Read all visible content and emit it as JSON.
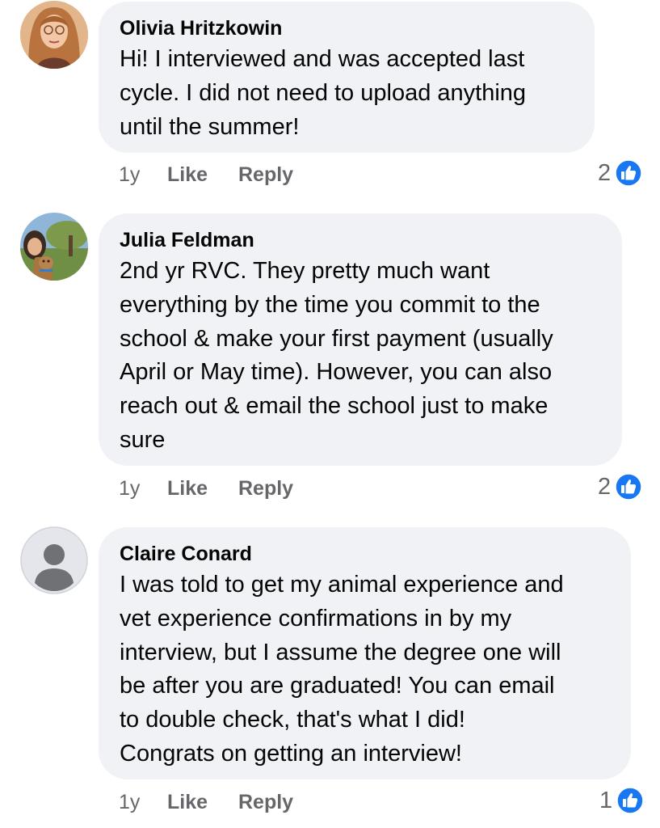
{
  "comments": [
    {
      "author": "Olivia Hritzkowin",
      "text": "Hi! I interviewed and was accepted last\ncycle. I did not need to upload anything\nuntil the summer!",
      "time": "1y",
      "like_label": "Like",
      "reply_label": "Reply",
      "reaction_count": "2",
      "reaction_icon": "like-thumb-icon"
    },
    {
      "author": "Julia Feldman",
      "text": "2nd yr RVC. They pretty much want\neverything by the time you commit to the\nschool & make your first payment (usually\nApril or May time). However, you can also\nreach out & email the school just to make\nsure",
      "time": "1y",
      "like_label": "Like",
      "reply_label": "Reply",
      "reaction_count": "2",
      "reaction_icon": "like-thumb-icon"
    },
    {
      "author": "Claire Conard",
      "text": "I was told to get my animal experience and\nvet experience confirmations in by my\ninterview, but I assume the degree one will\nbe after you are graduated! You can email\nto double check, that's what I did!\nCongrats on getting an interview!",
      "time": "1y",
      "like_label": "Like",
      "reply_label": "Reply",
      "reaction_count": "1",
      "reaction_icon": "like-thumb-icon"
    }
  ],
  "colors": {
    "bubble": "#f0f2f5",
    "text": "#050505",
    "secondary": "#65676b",
    "like_blue": "#1877f2"
  }
}
